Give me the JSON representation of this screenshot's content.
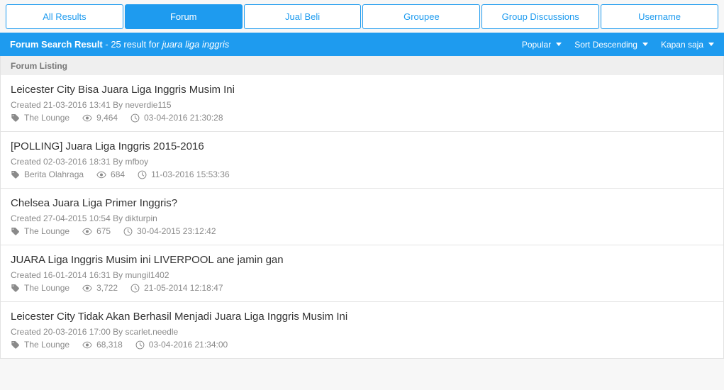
{
  "tabs": [
    {
      "label": "All Results",
      "active": false
    },
    {
      "label": "Forum",
      "active": true
    },
    {
      "label": "Jual Beli",
      "active": false
    },
    {
      "label": "Groupee",
      "active": false
    },
    {
      "label": "Group Discussions",
      "active": false
    },
    {
      "label": "Username",
      "active": false
    }
  ],
  "header": {
    "title": "Forum Search Result",
    "count_text": " - 25 result for ",
    "query": "juara liga inggris",
    "controls": [
      {
        "label": "Popular",
        "icon": "chevron-down-icon"
      },
      {
        "label": "Sort Descending",
        "icon": "chevron-down-icon"
      },
      {
        "label": "Kapan saja",
        "icon": "chevron-down-icon"
      }
    ]
  },
  "listing": {
    "section_label": "Forum Listing",
    "items": [
      {
        "title": "Leicester City Bisa Juara Liga Inggris Musim Ini",
        "created": "Created 21-03-2016 13:41 By neverdie115",
        "category": "The Lounge",
        "views": "9,464",
        "last_post": "03-04-2016 21:30:28"
      },
      {
        "title": "[POLLING] Juara Liga Inggris 2015-2016",
        "created": "Created 02-03-2016 18:31 By mfboy",
        "category": "Berita Olahraga",
        "views": "684",
        "last_post": "11-03-2016 15:53:36"
      },
      {
        "title": "Chelsea Juara Liga Primer Inggris?",
        "created": "Created 27-04-2015 10:54 By dikturpin",
        "category": "The Lounge",
        "views": "675",
        "last_post": "30-04-2015 23:12:42"
      },
      {
        "title": "JUARA Liga Inggris Musim ini LIVERPOOL ane jamin gan",
        "created": "Created 16-01-2014 16:31 By mungil1402",
        "category": "The Lounge",
        "views": "3,722",
        "last_post": "21-05-2014 12:18:47"
      },
      {
        "title": "Leicester City Tidak Akan Berhasil Menjadi Juara Liga Inggris Musim Ini",
        "created": "Created 20-03-2016 17:00 By scarlet.needle",
        "category": "The Lounge",
        "views": "68,318",
        "last_post": "03-04-2016 21:34:00"
      }
    ]
  },
  "colors": {
    "accent": "#1e9bef",
    "page_bg": "#f7f7f7",
    "subheader_bg": "#efefef",
    "title_text": "#333333",
    "meta_text": "#8a8a8a"
  }
}
